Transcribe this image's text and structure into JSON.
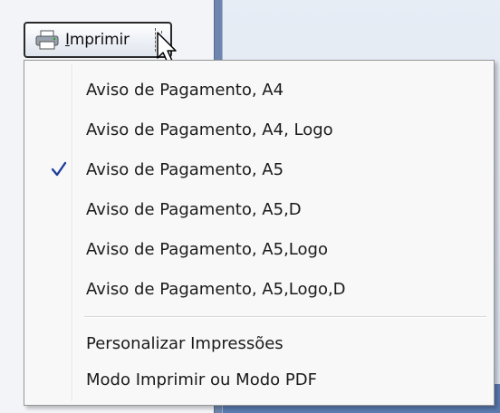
{
  "toolbar": {
    "print_button": {
      "label_underlined": "I",
      "label_rest": "mprimir",
      "icon": "printer-icon"
    }
  },
  "menu": {
    "items": [
      {
        "label": "Aviso de Pagamento, A4",
        "checked": false
      },
      {
        "label": "Aviso de Pagamento, A4, Logo",
        "checked": false
      },
      {
        "label": "Aviso de Pagamento, A5",
        "checked": true
      },
      {
        "label": "Aviso de Pagamento, A5,D",
        "checked": false
      },
      {
        "label": "Aviso de Pagamento, A5,Logo",
        "checked": false
      },
      {
        "label": "Aviso de Pagamento, A5,Logo,D",
        "checked": false
      }
    ],
    "extra_items": [
      {
        "label": "Personalizar Impressões"
      },
      {
        "label": "Modo Imprimir ou Modo PDF"
      }
    ],
    "check_icon": "checkmark-icon"
  },
  "colors": {
    "check": "#1f3e9a",
    "divider": "#6e86ad"
  }
}
